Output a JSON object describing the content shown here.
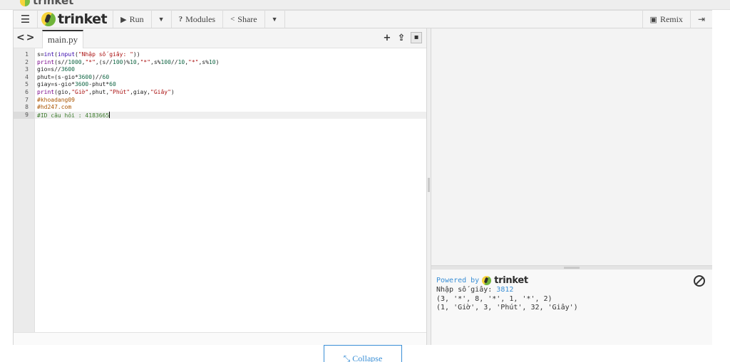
{
  "menubar": {
    "logo_text": "trinket",
    "run_label": "Run",
    "modules_label": "Modules",
    "share_label": "Share",
    "remix_label": "Remix"
  },
  "editor": {
    "file_tab": "main.py",
    "active_line": 9,
    "lines": [
      {
        "n": "1",
        "html": "s=<span class=\"fn\">int</span>(<span class=\"fn\">input</span>(<span class=\"st\">\"Nhập số giây: \"</span>))"
      },
      {
        "n": "2",
        "html": "<span class=\"kw\">print</span>(s//<span class=\"nm\">1000</span>,<span class=\"st\">\"*\"</span>,(s//<span class=\"nm\">100</span>)%<span class=\"nm\">10</span>,<span class=\"st\">\"*\"</span>,s%<span class=\"nm\">100</span>//<span class=\"nm\">10</span>,<span class=\"st\">\"*\"</span>,s%<span class=\"nm\">10</span>)"
      },
      {
        "n": "3",
        "html": "gio=s//<span class=\"nm\">3600</span>"
      },
      {
        "n": "4",
        "html": "phut=(s-gio*<span class=\"nm\">3600</span>)//<span class=\"nm\">60</span>"
      },
      {
        "n": "5",
        "html": "giay=s-gio*<span class=\"nm\">3600</span>-phut*<span class=\"nm\">60</span>"
      },
      {
        "n": "6",
        "html": "<span class=\"kw\">print</span>(gio,<span class=\"st\">\"Giờ\"</span>,phut,<span class=\"st\">\"Phút\"</span>,giay,<span class=\"st\">\"Giây\"</span>)"
      },
      {
        "n": "7",
        "html": "<span class=\"cm\">#khoadang09</span>"
      },
      {
        "n": "8",
        "html": "<span class=\"cm\">#hd247.com</span>"
      },
      {
        "n": "9",
        "html": "<span class=\"cmg\">#ID câu hỏi : 4183665</span><span class=\"cursor\"></span>"
      }
    ]
  },
  "console": {
    "powered_by": "Powered by",
    "powered_brand": "trinket",
    "prompt": "Nhập số giây: ",
    "input_value": "3812",
    "out_line_1": "(3, '*', 8, '*', 1, '*', 2)",
    "out_line_2": "(1, 'Giờ', 3, 'Phút', 32, 'Giây')"
  },
  "footer": {
    "collapse_label": "Collapse"
  }
}
